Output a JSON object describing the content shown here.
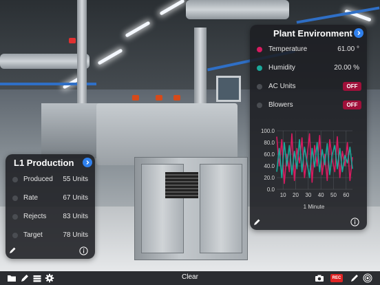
{
  "l1_production": {
    "title": "L1 Production",
    "rows": [
      {
        "label": "Produced",
        "value": "55 Units"
      },
      {
        "label": "Rate",
        "value": "67 Units"
      },
      {
        "label": "Rejects",
        "value": "83 Units"
      },
      {
        "label": "Target",
        "value": "78 Units"
      }
    ]
  },
  "plant_environment": {
    "title": "Plant Environment",
    "temperature": {
      "label": "Temperature",
      "value": "61.00 °",
      "color": "#d81b60"
    },
    "humidity": {
      "label": "Humidity",
      "value": "20.00 %",
      "color": "#1aa89a"
    },
    "ac_units": {
      "label": "AC Units",
      "state": "OFF"
    },
    "blowers": {
      "label": "Blowers",
      "state": "OFF"
    },
    "toggle_color": "#a0103a"
  },
  "chart_data": {
    "type": "line",
    "xlabel": "1 Minute",
    "ylim": [
      0,
      100
    ],
    "yticks": [
      "100.0",
      "80.0",
      "60.0",
      "40.0",
      "20.0",
      "0.0"
    ],
    "xticks": [
      "10",
      "20",
      "30",
      "40",
      "50",
      "60"
    ],
    "x": [
      5,
      7,
      9,
      11,
      13,
      15,
      17,
      19,
      21,
      23,
      25,
      27,
      29,
      31,
      33,
      35,
      37,
      39,
      41,
      43,
      45,
      47,
      49,
      51,
      53,
      55,
      57,
      59,
      61,
      63,
      65
    ],
    "series": [
      {
        "color": "#d81b60",
        "values": [
          90,
          40,
          85,
          10,
          60,
          30,
          95,
          15,
          70,
          45,
          88,
          20,
          55,
          95,
          12,
          75,
          40,
          92,
          25,
          60,
          15,
          85,
          50,
          30,
          90,
          20,
          65,
          40,
          80,
          15,
          55
        ]
      },
      {
        "color": "#1aa89a",
        "values": [
          30,
          70,
          20,
          80,
          40,
          75,
          25,
          65,
          35,
          85,
          30,
          72,
          45,
          20,
          70,
          38,
          80,
          30,
          68,
          42,
          78,
          25,
          60,
          75,
          35,
          70,
          30,
          58,
          45,
          72,
          35
        ]
      }
    ]
  },
  "toolbar": {
    "clear_label": "Clear",
    "rec_label": "REC"
  },
  "icons": {
    "folder": "folder-icon",
    "pencil": "pencil-icon",
    "layers": "layers-icon",
    "gear": "gear-icon",
    "camera": "camera-icon",
    "record": "record-icon",
    "pen": "pen-icon",
    "target": "target-icon"
  }
}
